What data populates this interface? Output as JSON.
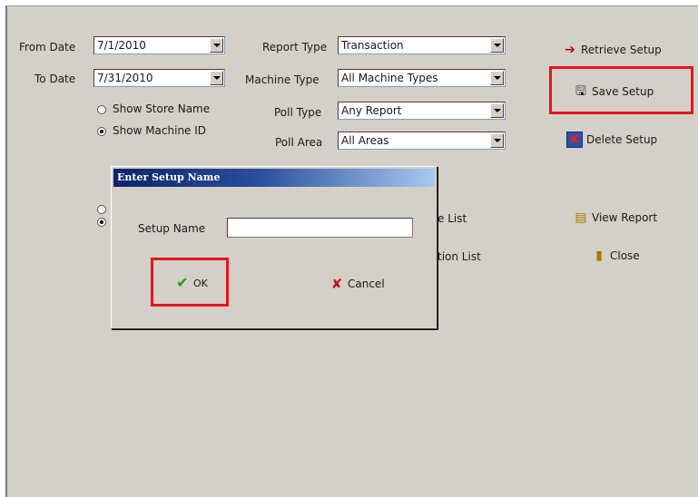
{
  "form": {
    "from_date_label": "From Date",
    "from_date_value": "7/1/2010",
    "to_date_label": "To Date",
    "to_date_value": "7/31/2010",
    "show_store_name": "Show Store Name",
    "show_machine_id": "Show Machine ID",
    "report_type_label": "Report Type",
    "report_type_value": "Transaction",
    "machine_type_label": "Machine Type",
    "machine_type_value": "All Machine Types",
    "poll_type_label": "Poll Type",
    "poll_type_value": "Any Report",
    "poll_area_label": "Poll Area",
    "poll_area_value": "All Areas",
    "hidden_label_1": "e List",
    "hidden_label_2": "tion List"
  },
  "actions": {
    "retrieve_setup": "Retrieve Setup",
    "save_setup": "Save Setup",
    "delete_setup": "Delete Setup",
    "view_report": "View Report",
    "close": "Close"
  },
  "dialog": {
    "title": "Enter Setup Name",
    "setup_name_label": "Setup Name",
    "setup_name_value": "",
    "ok_label": "OK",
    "cancel_label": "Cancel"
  },
  "colors": {
    "highlight": "#e8141c",
    "titlebar_start": "#0a246a",
    "titlebar_end": "#a6caf0",
    "window_bg": "#d4d0c8"
  }
}
